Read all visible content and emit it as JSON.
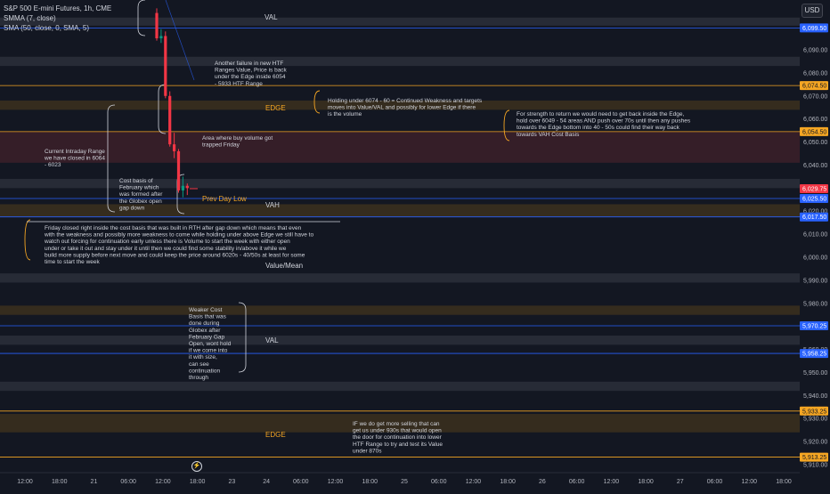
{
  "legend": {
    "symbol": "S&P 500 E-mini Futures, 1h, CME",
    "smma": "SMMA (7, close)",
    "sma": "SMA (50, close, 0, SMA, 5)"
  },
  "currency_button": "USD",
  "colors": {
    "background": "#131722",
    "bear_candle": "#f23645",
    "bull_candle": "#089981",
    "orange_line": "#f5a623",
    "blue_line": "#2962ff",
    "band_gray": "#2a2e39",
    "band_brown": "#3a2f1e",
    "band_red": "#3a1f29",
    "text": "#d1d4dc"
  },
  "chart_data": {
    "type": "candlestick",
    "y_axis": {
      "ylim": [
        5910,
        6104
      ],
      "tick_labels": [
        "6,090.00",
        "6,080.00",
        "6,070.00",
        "6,060.00",
        "6,050.00",
        "6,040.00",
        "6,030.00",
        "6,020.00",
        "6,010.00",
        "6,000.00",
        "5,990.00",
        "5,980.00",
        "5,970.00",
        "5,960.00",
        "5,950.00",
        "5,940.00",
        "5,930.00",
        "5,920.00",
        "5,910.00"
      ]
    },
    "x_axis": {
      "tick_labels": [
        "12:00",
        "18:00",
        "21",
        "06:00",
        "12:00",
        "18:00",
        "23",
        "24",
        "06:00",
        "12:00",
        "18:00",
        "25",
        "06:00",
        "12:00",
        "18:00",
        "26",
        "06:00",
        "12:00",
        "18:00",
        "27",
        "06:00",
        "12:00",
        "18:00"
      ]
    },
    "candles": [
      {
        "o": 6106,
        "h": 6108,
        "l": 6094,
        "c": 6095
      },
      {
        "o": 6095,
        "h": 6099,
        "l": 6093,
        "c": 6096
      },
      {
        "o": 6096,
        "h": 6098,
        "l": 6069,
        "c": 6070
      },
      {
        "o": 6070,
        "h": 6072,
        "l": 6048,
        "c": 6049
      },
      {
        "o": 6049,
        "h": 6054,
        "l": 6043,
        "c": 6046
      },
      {
        "o": 6046,
        "h": 6047,
        "l": 6028,
        "c": 6029
      },
      {
        "o": 6029,
        "h": 6035,
        "l": 6026,
        "c": 6031
      },
      {
        "o": 6031,
        "h": 6032,
        "l": 6027,
        "c": 6030
      }
    ],
    "price_badges": [
      {
        "value": "6,099.50",
        "color": "#2962ff"
      },
      {
        "value": "6,074.50",
        "color": "#f5a623"
      },
      {
        "value": "6,054.50",
        "color": "#f5a623"
      },
      {
        "value": "6,029.75",
        "color": "#f23645"
      },
      {
        "value": "6,025.50",
        "color": "#2962ff"
      },
      {
        "value": "6,017.50",
        "color": "#2962ff"
      },
      {
        "value": "5,970.25",
        "color": "#2962ff"
      },
      {
        "value": "5,958.25",
        "color": "#2962ff"
      },
      {
        "value": "5,933.25",
        "color": "#f5a623"
      },
      {
        "value": "5,913.25",
        "color": "#f5a623"
      }
    ],
    "level_lines": [
      {
        "value": 6099.5,
        "color": "#2962ff"
      },
      {
        "value": 6074.5,
        "color": "#f5a623"
      },
      {
        "value": 6054.5,
        "color": "#f5a623"
      },
      {
        "value": 6025.5,
        "color": "#2962ff"
      },
      {
        "value": 6017.5,
        "color": "#2962ff"
      },
      {
        "value": 5970.25,
        "color": "#2962ff"
      },
      {
        "value": 5958.25,
        "color": "#2962ff"
      },
      {
        "value": 5933.25,
        "color": "#f5a623"
      },
      {
        "value": 5913.25,
        "color": "#f5a623"
      }
    ],
    "zones": [
      {
        "from": 6100.5,
        "to": 6104,
        "kind": "gray"
      },
      {
        "from": 6083,
        "to": 6087,
        "kind": "gray"
      },
      {
        "from": 6064,
        "to": 6068,
        "kind": "brown"
      },
      {
        "from": 6041,
        "to": 6054.5,
        "kind": "red"
      },
      {
        "from": 6030,
        "to": 6034,
        "kind": "gray"
      },
      {
        "from": 6017.5,
        "to": 6023,
        "kind": "brown"
      },
      {
        "from": 5989,
        "to": 5993,
        "kind": "gray"
      },
      {
        "from": 5975,
        "to": 5979,
        "kind": "brown"
      },
      {
        "from": 5962,
        "to": 5966,
        "kind": "gray"
      },
      {
        "from": 5942,
        "to": 5946,
        "kind": "gray"
      },
      {
        "from": 5924,
        "to": 5932,
        "kind": "brown"
      }
    ],
    "annotations": {
      "val_top": "VAL",
      "ranges_note": "Another failure in new HTF Ranges Value, Price is back under the Edge inside 6054 - 5933 HTF Range",
      "holding_note": "Holding under 6074 - 60 = Continued Weakness and targets moves into Value/VAL and possibly for lower Edge if there is the volume",
      "edge_top": "EDGE",
      "strength_note": "For strength to return we would need to get back inside the Edge, hold over 6049 - 54 areas AND push over 70s until then any pushes towards the Edge bottom into 40 - 50s could find their way back towards VAH Cost Basis",
      "buy_volume_note": "Area where buy volume got trapped Friday",
      "intraday_note": "Current Intraday Range we have closed in 6064 - 6023",
      "cost_basis_note": "Cost basis of February which was formed after the Globex open gap down",
      "prev_day_low": "Prev Day Low",
      "vah": "VAH",
      "friday_note": "Friday closed right inside the cost basis that was built in RTH after gap down which means that even with the weakness and possibly more weakness to come while holding under above Edge we still have to watch out forcing for continuation early unless there is Volume to start the week with either open under or take it out and stay under it until then we could find some stability in/above it while we build more supply before next move and could keep the price around 6020s - 40/50s at least for some time to start the week",
      "value_mean": "Value/Mean",
      "weaker_note": "Weaker Cost Basis that was done during Globex after February Gap Open, wont hold if we come into it with size, can see continuation through",
      "val_mid": "VAL",
      "selling_note": "IF we do get more selling that can get us under 930s that would open the door for continuation into lower HTF Range to try and test its Value under 870s",
      "edge_bottom": "EDGE"
    }
  }
}
